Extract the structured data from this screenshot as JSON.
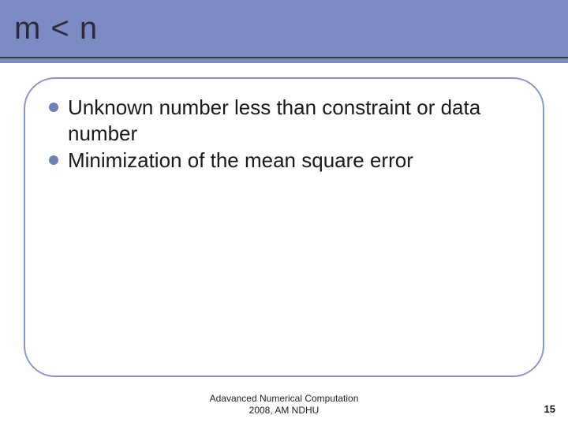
{
  "slide": {
    "title": "m < n",
    "bullets": [
      "Unknown number less than constraint or data number",
      "Minimization of the mean square error"
    ],
    "footer_line1": "Adavanced Numerical Computation",
    "footer_line2": "2008, AM NDHU",
    "page_number": "15"
  },
  "colors": {
    "header_bg": "#7d8bc4",
    "bullet_dot": "#6f7fb8",
    "frame_border": "#8a96c8"
  }
}
